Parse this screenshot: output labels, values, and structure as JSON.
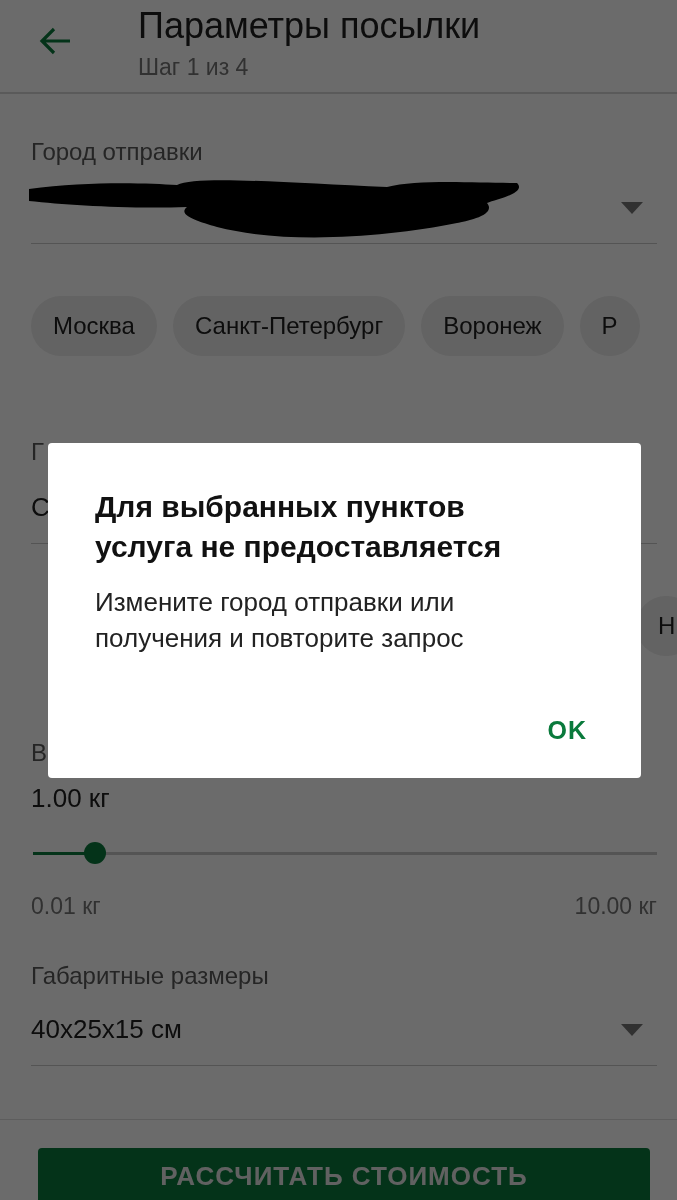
{
  "app_bar": {
    "title": "Параметры посылки",
    "subtitle": "Шаг 1 из 4"
  },
  "sender": {
    "label": "Город отправки",
    "chips": [
      "Москва",
      "Санкт-Петербург",
      "Воронеж",
      "Р"
    ]
  },
  "receiver": {
    "label": "Г",
    "value": "С",
    "chips": [
      "Н"
    ]
  },
  "weight": {
    "label": "В",
    "value": "1.00 кг",
    "level": 0.1,
    "min": "0.01 кг",
    "max": "10.00 кг"
  },
  "dimensions": {
    "label": "Габаритные размеры",
    "value": "40x25x15 см"
  },
  "calculate_button": "РАССЧИТАТЬ СТОИМОСТЬ",
  "dialog": {
    "title": "Для выбранных пунктов услуга не предоставляется",
    "message": "Измените город отправки или получения и повторите запрос",
    "button": "OK"
  }
}
